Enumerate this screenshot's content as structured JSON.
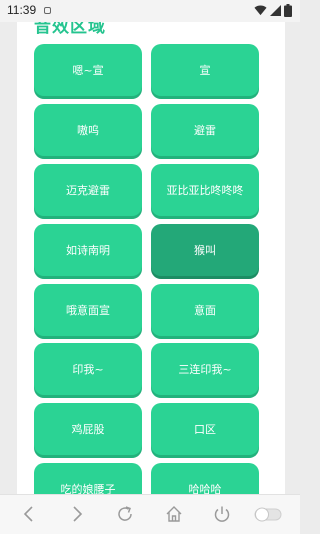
{
  "status_bar": {
    "time": "11:39",
    "icons": [
      "wifi-icon",
      "signal-icon",
      "battery-icon"
    ]
  },
  "section": {
    "title": "音效区域"
  },
  "sound_buttons": [
    {
      "label": "嗯~宣"
    },
    {
      "label": "宣"
    },
    {
      "label": "嗷呜"
    },
    {
      "label": "避雷"
    },
    {
      "label": "迈克避雷"
    },
    {
      "label": "亚比亚比咚咚咚"
    },
    {
      "label": "如诗南明"
    },
    {
      "label": "猴叫",
      "active": true
    },
    {
      "label": "哦意面宣"
    },
    {
      "label": "意面"
    },
    {
      "label": "印我~"
    },
    {
      "label": "三连印我~"
    },
    {
      "label": "鸡屁股"
    },
    {
      "label": "口区"
    },
    {
      "label": "吃的娘腰子"
    },
    {
      "label": "哈哈哈"
    }
  ],
  "bottom_nav": {
    "icons": [
      "back-icon",
      "forward-icon",
      "refresh-icon",
      "home-icon",
      "power-icon",
      "toggle-icon"
    ]
  },
  "colors": {
    "accent": "#2bd394",
    "accent_active": "#23a878",
    "title": "#25c48f"
  }
}
